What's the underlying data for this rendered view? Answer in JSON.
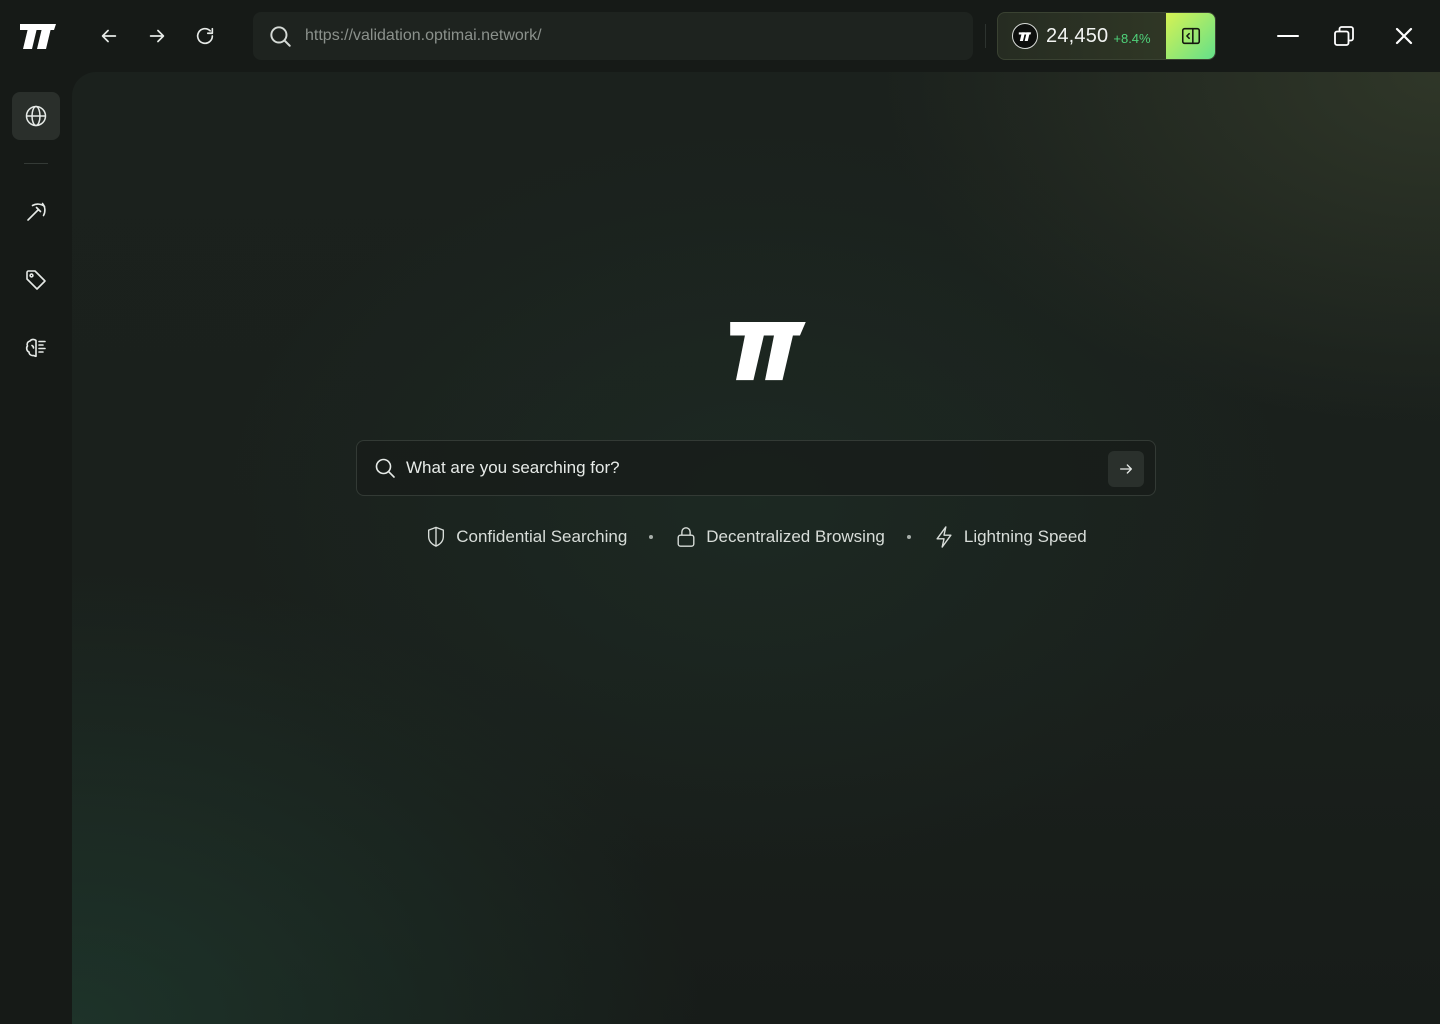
{
  "titlebar": {
    "url": "https://validation.optimai.network/",
    "wallet": {
      "balance": "24,450",
      "change": "+8.4%"
    }
  },
  "icons": {
    "brand": "optimai-logo",
    "back": "arrow-left-icon",
    "forward": "arrow-right-icon",
    "reload": "reload-icon",
    "url_search": "search-icon",
    "token": "optimai-token-icon",
    "panel_toggle": "side-panel-icon",
    "minimize": "minimize-icon",
    "restore": "restore-icon",
    "close": "close-icon",
    "sidebar": [
      "globe-icon",
      "pickaxe-icon",
      "tag-icon",
      "ai-brain-icon"
    ]
  },
  "main": {
    "search_placeholder": "What are you searching for?",
    "features": [
      {
        "icon": "shield-icon",
        "label": "Confidential Searching"
      },
      {
        "icon": "lock-icon",
        "label": "Decentralized Browsing"
      },
      {
        "icon": "lightning-icon",
        "label": "Lightning Speed"
      }
    ]
  },
  "colors": {
    "background": "#161a17",
    "accent_gradient_start": "#d6f253",
    "accent_gradient_end": "#63e08a",
    "positive_change": "#4fd27a"
  }
}
